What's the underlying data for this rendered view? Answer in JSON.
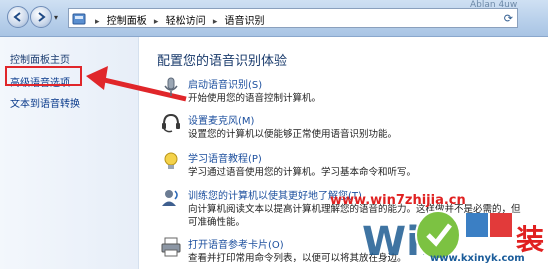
{
  "addressbar": {
    "crumbs": [
      "控制面板",
      "轻松访问",
      "语音识别"
    ],
    "recent_glyph": "▾"
  },
  "header_watermark": "Ablan 4uw",
  "left": {
    "home": "控制面板主页",
    "advanced": "高级语音选项",
    "tts": "文本到语音转换"
  },
  "main": {
    "title": "配置您的语音识别体验",
    "items": [
      {
        "title": "启动语音识别(S)",
        "desc": "开始使用您的语音控制计算机。",
        "desc2": ""
      },
      {
        "title": "设置麦克风(M)",
        "desc": "设置您的计算机以便能够正常使用语音识别功能。",
        "desc2": ""
      },
      {
        "title": "学习语音教程(P)",
        "desc": "学习通过语音使用您的计算机。学习基本命令和听写。",
        "desc2": ""
      },
      {
        "title": "训练您的计算机以使其更好地了解您(T)",
        "desc": "向计算机阅读文本以提高计算机理解您的语音的能力。这样做并不是必需的，但",
        "desc2": "可准确性能。"
      },
      {
        "title": "打开语音参考卡片(O)",
        "desc": "查看并打印常用命令列表，以便可以将其放在身边。",
        "desc2": ""
      }
    ]
  },
  "watermarks": {
    "site": "www.win7zhijia.cn",
    "logo_text": "Win",
    "bottom_url": "www.kxinyk.com",
    "red_text": "装"
  },
  "colors": {
    "link": "#1c4f9e",
    "highlight": "#e0262a",
    "title": "#1a3b6c"
  }
}
